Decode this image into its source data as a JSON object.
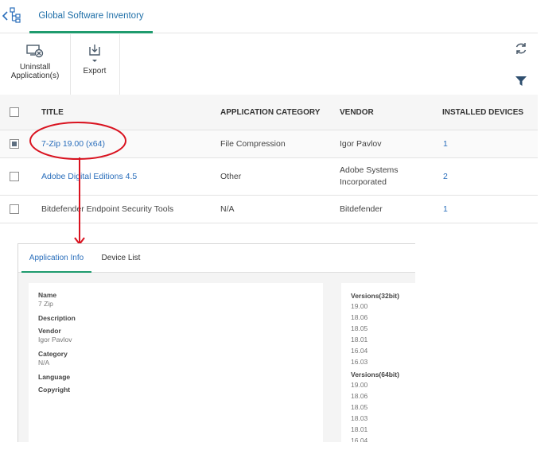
{
  "header": {
    "tab_label": "Global Software Inventory"
  },
  "toolbar": {
    "uninstall_line1": "Uninstall",
    "uninstall_line2": "Application(s)",
    "export_label": "Export"
  },
  "grid": {
    "columns": [
      "TITLE",
      "APPLICATION CATEGORY",
      "VENDOR",
      "INSTALLED DEVICES"
    ],
    "rows": [
      {
        "title": "7-Zip 19.00 (x64)",
        "category": "File Compression",
        "vendor": "Igor Pavlov",
        "vendor2": "",
        "devices": "1",
        "checked": true
      },
      {
        "title": "Adobe Digital Editions 4.5",
        "category": "Other",
        "vendor": "Adobe Systems",
        "vendor2": "Incorporated",
        "devices": "2",
        "checked": false
      },
      {
        "title": "Bitdefender Endpoint Security Tools",
        "category": "N/A",
        "vendor": "Bitdefender",
        "vendor2": "",
        "devices": "1",
        "checked": false
      }
    ]
  },
  "detail": {
    "tabs": [
      "Application Info",
      "Device List"
    ],
    "info": {
      "name_label": "Name",
      "name_value": "7 Zip",
      "description_label": "Description",
      "vendor_label": "Vendor",
      "vendor_value": "Igor Pavlov",
      "category_label": "Category",
      "category_value": "N/A",
      "language_label": "Language",
      "copyright_label": "Copyright"
    },
    "versions32_label": "Versions(32bit)",
    "versions32": [
      "19.00",
      "18.06",
      "18.05",
      "18.01",
      "16.04",
      "16.03"
    ],
    "versions64_label": "Versions(64bit)",
    "versions64": [
      "19.00",
      "18.06",
      "18.05",
      "18.03",
      "18.01",
      "16.04"
    ]
  },
  "colors": {
    "accent_green": "#1f9b6e",
    "link_blue": "#2a6ebb",
    "annotation_red": "#d9121f"
  }
}
